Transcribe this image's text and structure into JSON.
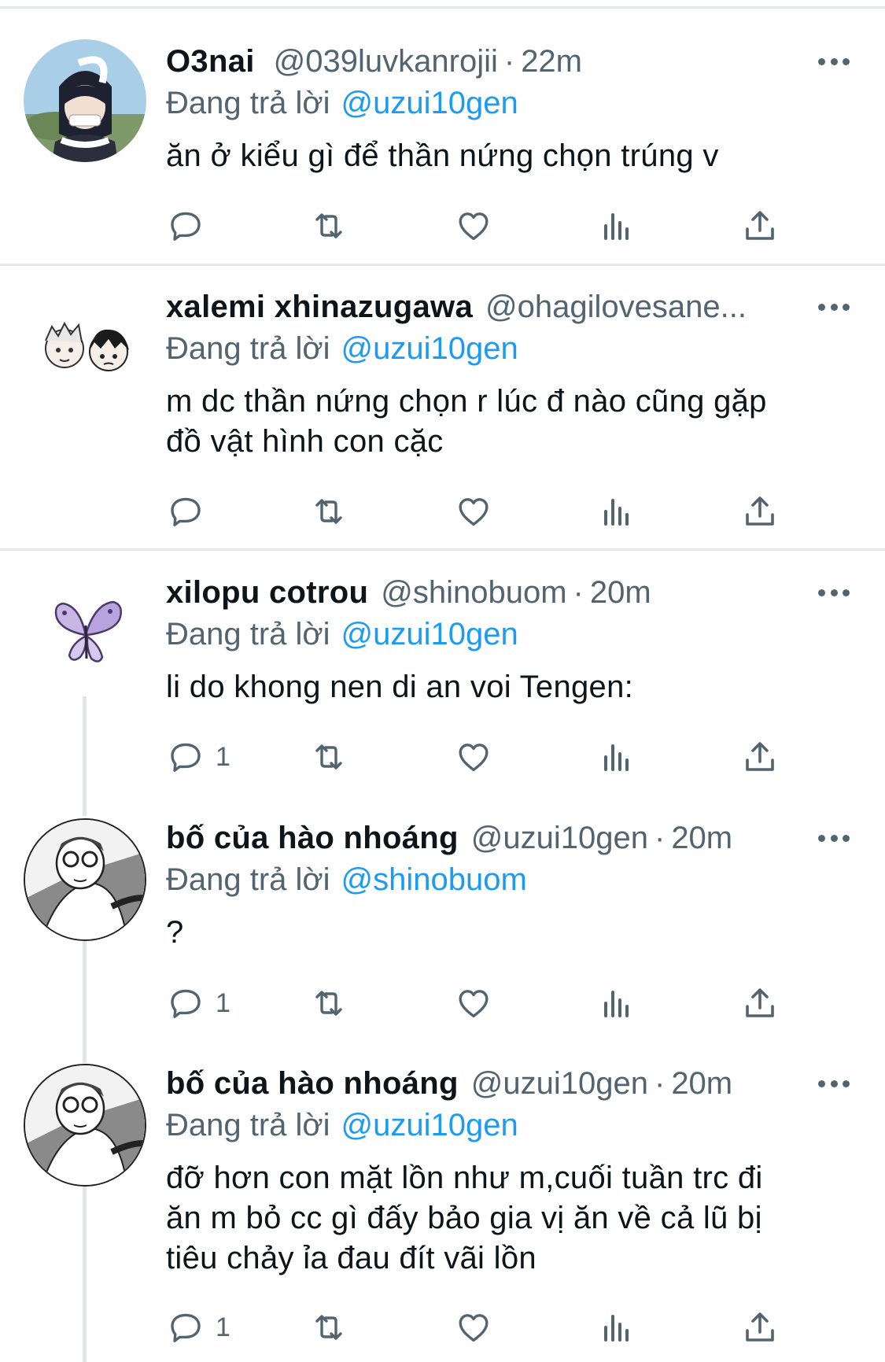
{
  "tweets": [
    {
      "name": "O3nai",
      "handle": "@039luvkanrojii",
      "sep": "·",
      "time": "22m",
      "reply_prefix": "Đang trả lời",
      "reply_to": "@uzui10gen",
      "text": "ăn ở kiểu gì để thần nứng chọn trúng v",
      "reply_count": "",
      "avatar": "character-avatar-dark-hair"
    },
    {
      "name": "xalemi xhinazugawa",
      "handle": "@ohagilovesane...",
      "sep": "",
      "time": "",
      "reply_prefix": "Đang trả lời",
      "reply_to": "@uzui10gen",
      "text": "m dc thần nứng chọn r lúc đ nào cũng gặp\nđồ vật hình con cặc",
      "reply_count": "",
      "avatar": "two-chibi-faces-avatar"
    },
    {
      "name": "xilopu cotrou",
      "handle": "@shinobuom",
      "sep": "·",
      "time": "20m",
      "reply_prefix": "Đang trả lời",
      "reply_to": "@uzui10gen",
      "text": "li do khong nen di an voi Tengen:",
      "reply_count": "1",
      "avatar": "butterfly-avatar"
    },
    {
      "name": "bố của hào nhoáng",
      "handle": "@uzui10gen",
      "sep": "·",
      "time": "20m",
      "reply_prefix": "Đang trả lời",
      "reply_to": "@shinobuom",
      "text": "?",
      "reply_count": "1",
      "avatar": "manga-character-avatar"
    },
    {
      "name": "bố của hào nhoáng",
      "handle": "@uzui10gen",
      "sep": "·",
      "time": "20m",
      "reply_prefix": "Đang trả lời",
      "reply_to": "@uzui10gen",
      "text": "đỡ hơn con mặt lồn như m,cuối tuần trc đi\năn m bỏ cc gì đấy bảo gia vị ăn về cả lũ bị\ntiêu chảy ỉa đau đít vãi lồn",
      "reply_count": "1",
      "avatar": "manga-character-avatar"
    }
  ],
  "colors": {
    "link": "#1d9bf0",
    "secondary_text": "#536471",
    "icon": "#536471",
    "divider": "#e6e9ec"
  },
  "icons": [
    "reply-icon",
    "retweet-icon",
    "like-icon",
    "views-icon",
    "share-icon",
    "more-icon"
  ]
}
